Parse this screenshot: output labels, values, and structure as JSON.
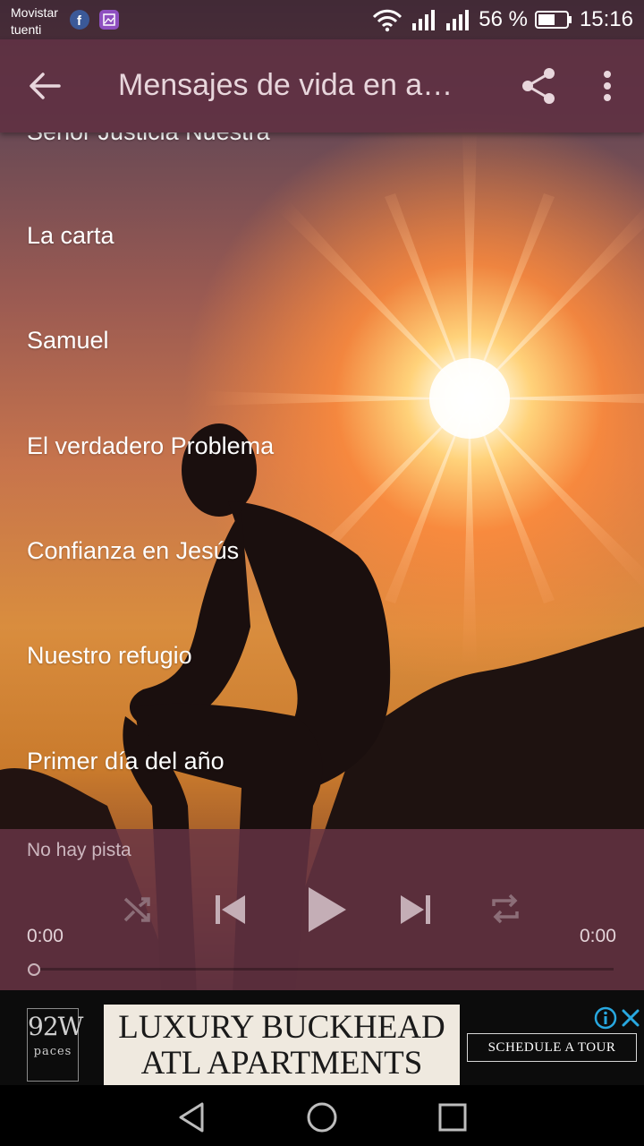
{
  "status_bar": {
    "carrier_line1": "Movistar",
    "carrier_line2": "tuenti",
    "notification_icons": [
      "facebook-icon",
      "gallery-icon"
    ],
    "battery_percent": "56 %",
    "time": "15:16"
  },
  "app_bar": {
    "title": "Mensajes de vida en a…",
    "back_icon": "arrow-left-icon",
    "share_icon": "share-icon",
    "more_icon": "more-vertical-icon"
  },
  "tracks": [
    "Señor Justicia Nuestra",
    "La carta",
    "Samuel",
    "El verdadero Problema",
    "Confianza en Jesús",
    "Nuestro refugio",
    "Primer día del año"
  ],
  "player": {
    "now_playing": "No hay pista",
    "current_time": "0:00",
    "total_time": "0:00",
    "progress": 0
  },
  "ad": {
    "logo_line1": "92W",
    "logo_line2": "paces",
    "headline_line1": "LUXURY BUCKHEAD",
    "headline_line2": "ATL APARTMENTS",
    "cta": "SCHEDULE A TOUR"
  },
  "colors": {
    "app_bar": "#603042",
    "player_bg": "#683446",
    "title_text": "#e8d6dc"
  }
}
